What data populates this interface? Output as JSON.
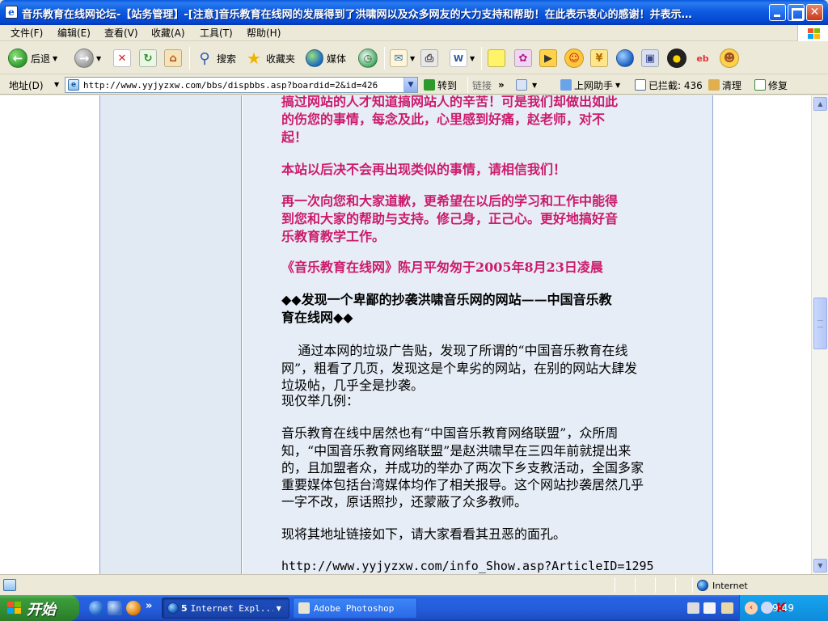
{
  "window": {
    "title": "音乐教育在线网论坛-【站务管理】-[注意]音乐教育在线网的发展得到了洪啸网以及众多网友的大力支持和帮助！在此表示衷心的感谢！并表示…",
    "title_icon_glyph": "e"
  },
  "menu": {
    "items": [
      "文件(F)",
      "编辑(E)",
      "查看(V)",
      "收藏(A)",
      "工具(T)",
      "帮助(H)"
    ]
  },
  "toolbar": {
    "back_label": "后退",
    "search_label": "搜索",
    "favorites_label": "收藏夹",
    "media_label": "媒体"
  },
  "address": {
    "label": "地址(D)",
    "url": "http://www.yyjyzxw.com/bbs/dispbbs.asp?boardid=2&id=426",
    "go_label": "转到",
    "links_label": "链接",
    "helper_label": "上网助手",
    "blocked_label": "已拦截: 436",
    "clean_label": "清理",
    "repair_label": "修复"
  },
  "post": {
    "para1": [
      "搞过网站的人才知道搞网站人的辛苦！可是我们却做出如此",
      "的伤您的事情，每念及此，心里感到好痛，赵老师，对不",
      "起！"
    ],
    "para2": "本站以后决不会再出现类似的事情，请相信我们！",
    "para3": [
      "再一次向您和大家道歉，更希望在以后的学习和工作中能得",
      "到您和大家的帮助与支持。修己身，正己心。更好地搞好音",
      "乐教育教学工作。"
    ],
    "signature": "《音乐教育在线网》陈月平匆匆于2005年8月23日凌晨",
    "heading": [
      "◆◆发现一个卑鄙的抄袭洪啸音乐网的网站——中国音乐教",
      "育在线网◆◆"
    ],
    "body1": [
      "    通过本网的垃圾广告贴，发现了所谓的“中国音乐教育在线",
      "网”，粗看了几页，发现这是个卑劣的网站，在别的网站大肆发",
      "垃圾帖，几乎全是抄袭。",
      "现仅举几例："
    ],
    "body2": [
      "音乐教育在线中居然也有“中国音乐教育网络联盟”，众所周",
      "知，“中国音乐教育网络联盟”是赵洪啸早在三四年前就提出来",
      "的，且加盟者众，并成功的举办了两次下乡支教活动，全国多家",
      "重要媒体包括台湾媒体均作了相关报导。这个网站抄袭居然几乎",
      "一字不改，原话照抄，还蒙蔽了众多教师。"
    ],
    "body3": "现将其地址链接如下，请大家看看其丑恶的面孔。",
    "link": "http://www.yyjyzxw.com/info_Show.asp?ArticleID=1295"
  },
  "status": {
    "zone": "Internet"
  },
  "taskbar": {
    "start_label": "开始",
    "tasks": [
      {
        "count": "5",
        "label": "Internet Expl..."
      },
      {
        "label": "Adobe Photoshop"
      }
    ],
    "clock": "9:49"
  },
  "colors": {
    "accent_pink": "#cc1b6c",
    "content_bg": "#e6edf6",
    "sidebar_bg": "#e1e9f3",
    "titlebar_blue": "#0448d2",
    "taskbar_blue": "#245edc",
    "start_green": "#318d31"
  }
}
